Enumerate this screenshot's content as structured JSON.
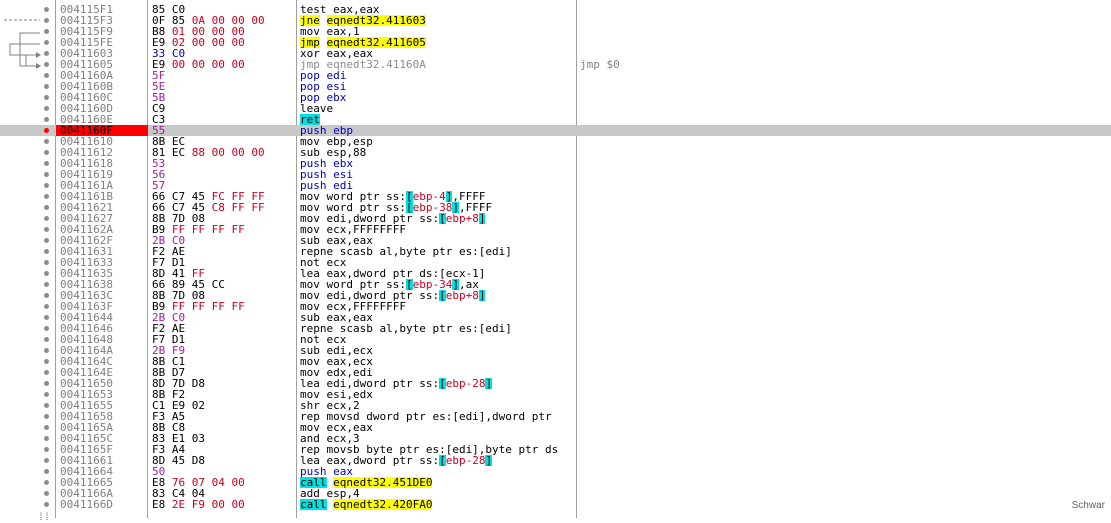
{
  "side_label": "Schwar",
  "rows": [
    {
      "addr": "004115F1",
      "bytes": [
        [
          "85",
          "n"
        ],
        [
          " C0",
          "n"
        ]
      ],
      "instr": [
        [
          "test ",
          "n"
        ],
        [
          "eax,eax",
          "n"
        ]
      ],
      "cmt": ""
    },
    {
      "addr": "004115F3",
      "bytes": [
        [
          "0F 85 ",
          "n"
        ],
        [
          "0A 00 00 00",
          "r"
        ]
      ],
      "instr": [
        [
          "jne",
          "jmp"
        ],
        [
          " ",
          "n"
        ],
        [
          "eqnedt32.411603",
          "jmp"
        ]
      ],
      "cmt": ""
    },
    {
      "addr": "004115F9",
      "bytes": [
        [
          "B8 ",
          "n"
        ],
        [
          "01 00 00 00",
          "r"
        ]
      ],
      "instr": [
        [
          "mov eax,1",
          "n"
        ]
      ],
      "cmt": ""
    },
    {
      "addr": "004115FE",
      "bytes": [
        [
          "E9 ",
          "n"
        ],
        [
          "02 00 00 00",
          "r"
        ]
      ],
      "instr": [
        [
          "jmp",
          "jmp"
        ],
        [
          " ",
          "n"
        ],
        [
          "eqnedt32.411605",
          "jmp"
        ]
      ],
      "cmt": ""
    },
    {
      "addr": "00411603",
      "bytes": [
        [
          "33 C0",
          "b"
        ]
      ],
      "instr": [
        [
          "xor eax,eax",
          "n"
        ]
      ],
      "cmt": ""
    },
    {
      "addr": "00411605",
      "bytes": [
        [
          "E9 ",
          "n"
        ],
        [
          "00 00 00 00",
          "r"
        ]
      ],
      "instr": [
        [
          "jmp eqnedt32.41160A",
          "g"
        ]
      ],
      "cmt": "jmp $0"
    },
    {
      "addr": "0041160A",
      "bytes": [
        [
          "5F",
          "p"
        ]
      ],
      "instr": [
        [
          "pop edi",
          "b"
        ]
      ],
      "cmt": ""
    },
    {
      "addr": "0041160B",
      "bytes": [
        [
          "5E",
          "p"
        ]
      ],
      "instr": [
        [
          "pop esi",
          "b"
        ]
      ],
      "cmt": ""
    },
    {
      "addr": "0041160C",
      "bytes": [
        [
          "5B",
          "p"
        ]
      ],
      "instr": [
        [
          "pop ebx",
          "b"
        ]
      ],
      "cmt": ""
    },
    {
      "addr": "0041160D",
      "bytes": [
        [
          "C9",
          "n"
        ]
      ],
      "instr": [
        [
          "leave",
          "n"
        ]
      ],
      "cmt": ""
    },
    {
      "addr": "0041160E",
      "bytes": [
        [
          "C3",
          "n"
        ]
      ],
      "instr": [
        [
          "ret",
          "ret"
        ]
      ],
      "cmt": ""
    },
    {
      "addr": "0041160F",
      "bytes": [
        [
          "55",
          "p"
        ]
      ],
      "instr": [
        [
          "push ebp",
          "b"
        ]
      ],
      "cmt": "",
      "current": true
    },
    {
      "addr": "00411610",
      "bytes": [
        [
          "8B EC",
          "n"
        ]
      ],
      "instr": [
        [
          "mov ebp,esp",
          "n"
        ]
      ],
      "cmt": ""
    },
    {
      "addr": "00411612",
      "bytes": [
        [
          "81 EC ",
          "n"
        ],
        [
          "88 00 00 00",
          "r"
        ]
      ],
      "instr": [
        [
          "sub esp,88",
          "n"
        ]
      ],
      "cmt": ""
    },
    {
      "addr": "00411618",
      "bytes": [
        [
          "53",
          "p"
        ]
      ],
      "instr": [
        [
          "push ebx",
          "b"
        ]
      ],
      "cmt": ""
    },
    {
      "addr": "00411619",
      "bytes": [
        [
          "56",
          "p"
        ]
      ],
      "instr": [
        [
          "push esi",
          "b"
        ]
      ],
      "cmt": ""
    },
    {
      "addr": "0041161A",
      "bytes": [
        [
          "57",
          "p"
        ]
      ],
      "instr": [
        [
          "push edi",
          "b"
        ]
      ],
      "cmt": ""
    },
    {
      "addr": "0041161B",
      "bytes": [
        [
          "66 C7 45 ",
          "n"
        ],
        [
          "FC FF FF",
          "r"
        ]
      ],
      "instr": [
        [
          "mov word ptr ss:",
          "n"
        ],
        [
          "[",
          "c"
        ],
        [
          "ebp-4",
          "r"
        ],
        [
          "]",
          "c"
        ],
        [
          ",FFFF",
          "n"
        ]
      ],
      "cmt": ""
    },
    {
      "addr": "00411621",
      "bytes": [
        [
          "66 C7 45 ",
          "n"
        ],
        [
          "C8 FF FF",
          "r"
        ]
      ],
      "instr": [
        [
          "mov word ptr ss:",
          "n"
        ],
        [
          "[",
          "c"
        ],
        [
          "ebp-38",
          "r"
        ],
        [
          "]",
          "c"
        ],
        [
          ",FFFF",
          "n"
        ]
      ],
      "cmt": ""
    },
    {
      "addr": "00411627",
      "bytes": [
        [
          "8B 7D ",
          "n"
        ],
        [
          "08",
          "n"
        ]
      ],
      "instr": [
        [
          "mov edi,dword ptr ss:",
          "n"
        ],
        [
          "[",
          "c"
        ],
        [
          "ebp+8",
          "r"
        ],
        [
          "]",
          "c"
        ]
      ],
      "cmt": ""
    },
    {
      "addr": "0041162A",
      "bytes": [
        [
          "B9 ",
          "n"
        ],
        [
          "FF FF FF FF",
          "r"
        ]
      ],
      "instr": [
        [
          "mov ecx,FFFFFFFF",
          "n"
        ]
      ],
      "cmt": ""
    },
    {
      "addr": "0041162F",
      "bytes": [
        [
          "2B C0",
          "p"
        ]
      ],
      "instr": [
        [
          "sub eax,eax",
          "n"
        ]
      ],
      "cmt": ""
    },
    {
      "addr": "00411631",
      "bytes": [
        [
          "F2 AE",
          "n"
        ]
      ],
      "instr": [
        [
          "repne scasb al,byte ptr es:[edi]",
          "n"
        ]
      ],
      "cmt": ""
    },
    {
      "addr": "00411633",
      "bytes": [
        [
          "F7 D1",
          "n"
        ]
      ],
      "instr": [
        [
          "not ecx",
          "n"
        ]
      ],
      "cmt": ""
    },
    {
      "addr": "00411635",
      "bytes": [
        [
          "8D 41 ",
          "n"
        ],
        [
          "FF",
          "r"
        ]
      ],
      "instr": [
        [
          "lea eax,dword ptr ds:[ecx-1]",
          "n"
        ]
      ],
      "cmt": ""
    },
    {
      "addr": "00411638",
      "bytes": [
        [
          "66 89 45 CC",
          "n"
        ]
      ],
      "instr": [
        [
          "mov word ptr ss:",
          "n"
        ],
        [
          "[",
          "c"
        ],
        [
          "ebp-34",
          "r"
        ],
        [
          "]",
          "c"
        ],
        [
          ",ax",
          "n"
        ]
      ],
      "cmt": ""
    },
    {
      "addr": "0041163C",
      "bytes": [
        [
          "8B 7D ",
          "n"
        ],
        [
          "08",
          "n"
        ]
      ],
      "instr": [
        [
          "mov edi,dword ptr ss:",
          "n"
        ],
        [
          "[",
          "c"
        ],
        [
          "ebp+8",
          "r"
        ],
        [
          "]",
          "c"
        ]
      ],
      "cmt": ""
    },
    {
      "addr": "0041163F",
      "bytes": [
        [
          "B9 ",
          "n"
        ],
        [
          "FF FF FF FF",
          "r"
        ]
      ],
      "instr": [
        [
          "mov ecx,FFFFFFFF",
          "n"
        ]
      ],
      "cmt": ""
    },
    {
      "addr": "00411644",
      "bytes": [
        [
          "2B C0",
          "p"
        ]
      ],
      "instr": [
        [
          "sub eax,eax",
          "n"
        ]
      ],
      "cmt": ""
    },
    {
      "addr": "00411646",
      "bytes": [
        [
          "F2 AE",
          "n"
        ]
      ],
      "instr": [
        [
          "repne scasb al,byte ptr es:[edi]",
          "n"
        ]
      ],
      "cmt": ""
    },
    {
      "addr": "00411648",
      "bytes": [
        [
          "F7 D1",
          "n"
        ]
      ],
      "instr": [
        [
          "not ecx",
          "n"
        ]
      ],
      "cmt": ""
    },
    {
      "addr": "0041164A",
      "bytes": [
        [
          "2B F9",
          "p"
        ]
      ],
      "instr": [
        [
          "sub edi,ecx",
          "n"
        ]
      ],
      "cmt": ""
    },
    {
      "addr": "0041164C",
      "bytes": [
        [
          "8B C1",
          "n"
        ]
      ],
      "instr": [
        [
          "mov eax,ecx",
          "n"
        ]
      ],
      "cmt": ""
    },
    {
      "addr": "0041164E",
      "bytes": [
        [
          "8B D7",
          "n"
        ]
      ],
      "instr": [
        [
          "mov edx,edi",
          "n"
        ]
      ],
      "cmt": ""
    },
    {
      "addr": "00411650",
      "bytes": [
        [
          "8D 7D ",
          "n"
        ],
        [
          "D8",
          "n"
        ]
      ],
      "instr": [
        [
          "lea edi,dword ptr ss:",
          "n"
        ],
        [
          "[",
          "c"
        ],
        [
          "ebp-28",
          "r"
        ],
        [
          "]",
          "c"
        ]
      ],
      "cmt": ""
    },
    {
      "addr": "00411653",
      "bytes": [
        [
          "8B F2",
          "n"
        ]
      ],
      "instr": [
        [
          "mov esi,edx",
          "n"
        ]
      ],
      "cmt": ""
    },
    {
      "addr": "00411655",
      "bytes": [
        [
          "C1 E9 ",
          "n"
        ],
        [
          "02",
          "n"
        ]
      ],
      "instr": [
        [
          "shr ecx,2",
          "n"
        ]
      ],
      "cmt": ""
    },
    {
      "addr": "00411658",
      "bytes": [
        [
          "F3 A5",
          "n"
        ]
      ],
      "instr": [
        [
          "rep movsd dword ptr es:[edi],dword ptr ",
          "n"
        ]
      ],
      "cmt": ""
    },
    {
      "addr": "0041165A",
      "bytes": [
        [
          "8B C8",
          "n"
        ]
      ],
      "instr": [
        [
          "mov ecx,eax",
          "n"
        ]
      ],
      "cmt": ""
    },
    {
      "addr": "0041165C",
      "bytes": [
        [
          "83 E1 ",
          "n"
        ],
        [
          "03",
          "n"
        ]
      ],
      "instr": [
        [
          "and ecx,3",
          "n"
        ]
      ],
      "cmt": ""
    },
    {
      "addr": "0041165F",
      "bytes": [
        [
          "F3 A4",
          "n"
        ]
      ],
      "instr": [
        [
          "rep movsb byte ptr es:[edi],byte ptr ds",
          "n"
        ]
      ],
      "cmt": ""
    },
    {
      "addr": "00411661",
      "bytes": [
        [
          "8D 45 ",
          "n"
        ],
        [
          "D8",
          "n"
        ]
      ],
      "instr": [
        [
          "lea eax,dword ptr ss:",
          "n"
        ],
        [
          "[",
          "c"
        ],
        [
          "ebp-28",
          "r"
        ],
        [
          "]",
          "c"
        ]
      ],
      "cmt": ""
    },
    {
      "addr": "00411664",
      "bytes": [
        [
          "50",
          "p"
        ]
      ],
      "instr": [
        [
          "push eax",
          "b"
        ]
      ],
      "cmt": ""
    },
    {
      "addr": "00411665",
      "bytes": [
        [
          "E8 ",
          "n"
        ],
        [
          "76 07 04 00",
          "r"
        ]
      ],
      "instr": [
        [
          "call",
          "call"
        ],
        [
          " ",
          "n"
        ],
        [
          "eqnedt32.451DE0",
          "jmp"
        ]
      ],
      "cmt": ""
    },
    {
      "addr": "0041166A",
      "bytes": [
        [
          "83 C4 ",
          "n"
        ],
        [
          "04",
          "n"
        ]
      ],
      "instr": [
        [
          "add esp,4",
          "n"
        ]
      ],
      "cmt": ""
    },
    {
      "addr": "0041166D",
      "bytes": [
        [
          "E8 ",
          "n"
        ],
        [
          "2E F9 00 00",
          "r"
        ]
      ],
      "instr": [
        [
          "call",
          "call"
        ],
        [
          " ",
          "n"
        ],
        [
          "eqnedt32.420FA0",
          "jmp"
        ]
      ],
      "cmt": ""
    }
  ]
}
